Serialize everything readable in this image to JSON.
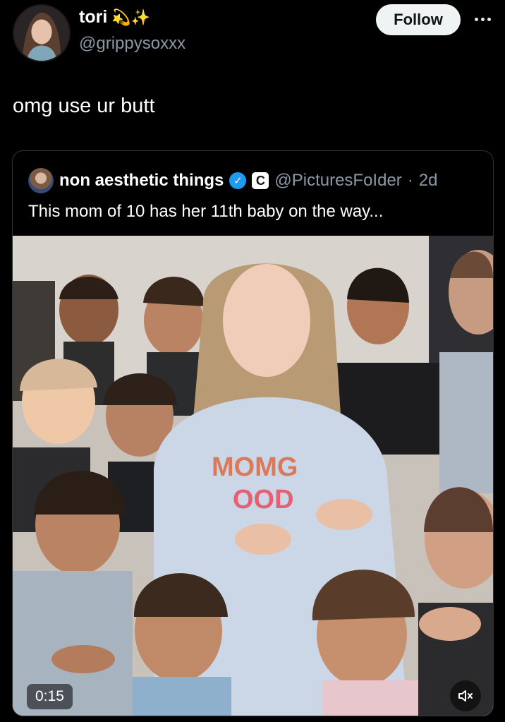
{
  "author": {
    "name": "tori",
    "emoji": "💫✨",
    "handle": "@grippysoxxx",
    "follow_label": "Follow"
  },
  "post": {
    "text": "omg use ur butt"
  },
  "quote": {
    "name": "non aesthetic things",
    "c_badge": "C",
    "handle": "@PicturesFoIder",
    "separator": "·",
    "time": "2d",
    "text": "This mom of 10 has her 11th baby on the way..."
  },
  "video": {
    "duration": "0:15",
    "sweatshirt_text": "MOMGOOD"
  },
  "colors": {
    "follow_bg": "#eff3f4",
    "verified": "#1d9bf0",
    "muted_text": "#8b98a5"
  },
  "icons": {
    "more": "more-icon",
    "verified": "verified-badge-icon",
    "mute": "speaker-muted-icon"
  }
}
